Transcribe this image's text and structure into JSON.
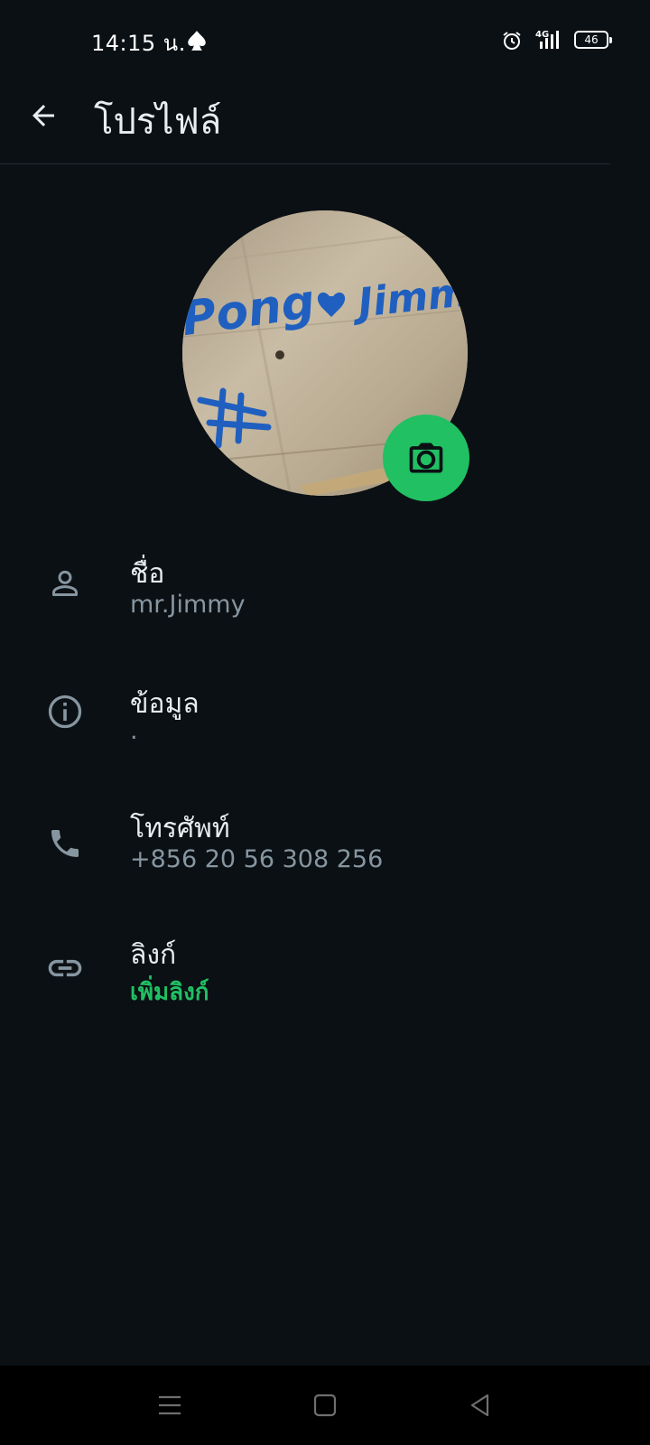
{
  "status_bar": {
    "time": "14:15 น.",
    "network": "4G",
    "battery": "46"
  },
  "app_bar": {
    "title": "โปรไฟล์"
  },
  "avatar": {
    "photo_text_left": "Pong",
    "photo_text_right": "Jimmy"
  },
  "rows": [
    {
      "label": "ชื่อ",
      "value": "mr.Jimmy",
      "icon": "person-icon"
    },
    {
      "label": "ข้อมูล",
      "value": ".",
      "icon": "info-icon"
    },
    {
      "label": "โทรศัพท์",
      "value": "+856 20 56 308 256",
      "icon": "phone-icon"
    },
    {
      "label": "ลิงก์",
      "value": "เพิ่มลิงก์",
      "icon": "link-icon"
    }
  ],
  "colors": {
    "background": "#0b1014",
    "accent": "#21c063",
    "secondary_text": "#8696a0"
  }
}
